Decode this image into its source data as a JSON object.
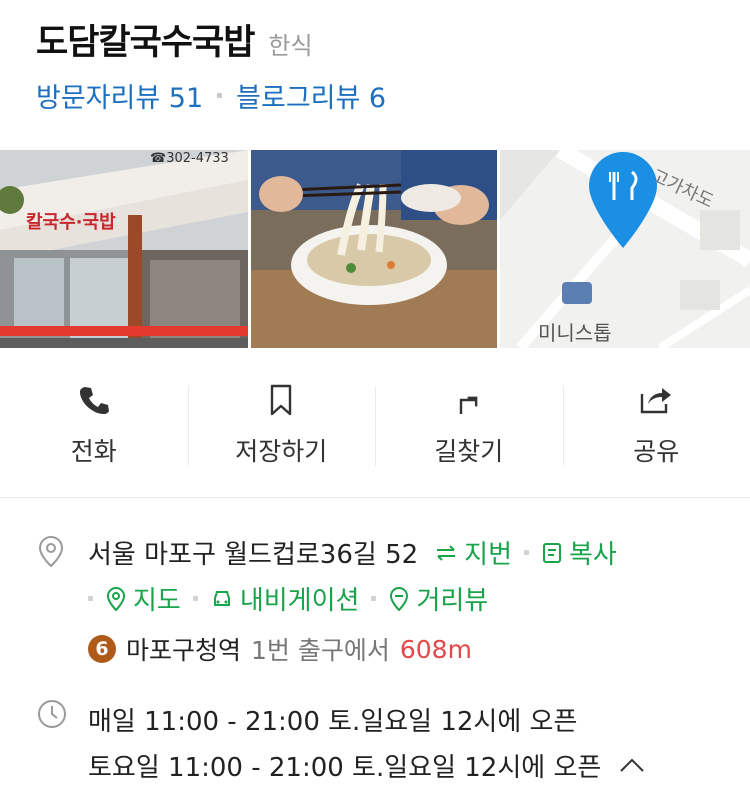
{
  "place": {
    "name": "도담칼국수국밥",
    "category": "한식",
    "visitor_reviews": "방문자리뷰 51",
    "blog_reviews": "블로그리뷰 6"
  },
  "photos": [
    {
      "name": "storefront-photo",
      "sign_phone": "☎302-4733",
      "sign_text": "칼국수·국밥"
    },
    {
      "name": "noodle-photo"
    },
    {
      "name": "map-thumbnail",
      "road_label": "고가차도",
      "poi_label": "미니스톱"
    }
  ],
  "actions": [
    {
      "label": "전화",
      "icon": "phone-icon"
    },
    {
      "label": "저장하기",
      "icon": "bookmark-icon"
    },
    {
      "label": "길찾기",
      "icon": "directions-icon"
    },
    {
      "label": "공유",
      "icon": "share-icon"
    }
  ],
  "address": {
    "text": "서울 마포구 월드컵로36길 52",
    "jibun": "지번",
    "copy": "복사",
    "map": "지도",
    "navigation": "내비게이션",
    "street_view": "거리뷰"
  },
  "subway": {
    "line": "6",
    "station": "마포구청역",
    "exit": "1번 출구에서",
    "distance": "608m",
    "line_color": "#b05a1a"
  },
  "hours": [
    "매일 11:00 - 21:00 토.일요일 12시에 오픈",
    "토요일 11:00 - 21:00 토.일요일 12시에 오픈"
  ],
  "colors": {
    "link_blue": "#1f6fbf",
    "accent_green": "#19a34a",
    "distance_red": "#e24a4a",
    "map_pin": "#1a8fe3"
  }
}
